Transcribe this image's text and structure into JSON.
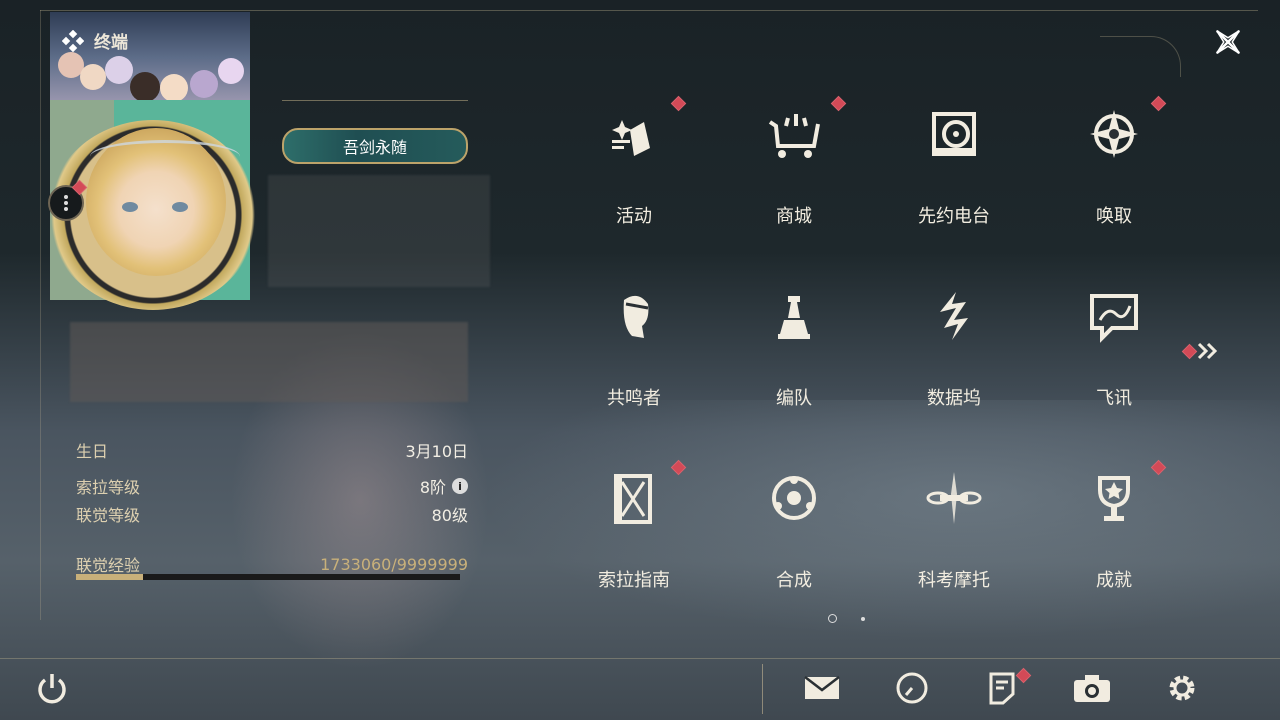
{
  "header": {
    "title": "终端"
  },
  "profile": {
    "title_badge": "吾剑永随",
    "birthday_label": "生日",
    "birthday_value": "3月10日",
    "sola_level_label": "索拉等级",
    "sola_level_value": "8阶",
    "union_level_label": "联觉等级",
    "union_level_value": "80级",
    "union_exp_label": "联觉经验",
    "union_exp_value": "1733060/9999999",
    "union_exp_progress": 0.1733
  },
  "grid": {
    "page1": [
      {
        "label": "活动",
        "icon": "activity-icon",
        "badge": true
      },
      {
        "label": "商城",
        "icon": "shop-cart-icon",
        "badge": true
      },
      {
        "label": "先约电台",
        "icon": "radio-icon",
        "badge": false
      },
      {
        "label": "唤取",
        "icon": "compass-star-icon",
        "badge": true
      },
      {
        "label": "共鸣者",
        "icon": "resonator-portrait-icon",
        "badge": false
      },
      {
        "label": "编队",
        "icon": "chess-team-icon",
        "badge": false
      },
      {
        "label": "数据坞",
        "icon": "data-dock-icon",
        "badge": false
      },
      {
        "label": "飞讯",
        "icon": "chat-bubble-icon",
        "badge": false
      },
      {
        "label": "索拉指南",
        "icon": "guide-book-icon",
        "badge": true
      },
      {
        "label": "合成",
        "icon": "synthesis-orb-icon",
        "badge": false
      },
      {
        "label": "科考摩托",
        "icon": "motorbike-icon",
        "badge": false
      },
      {
        "label": "成就",
        "icon": "trophy-icon",
        "badge": true
      }
    ]
  },
  "pager": {
    "current": 1,
    "total": 2
  },
  "bottom_bar": {
    "left": "power-icon",
    "right": [
      "mail-icon",
      "clock-icon",
      "notice-icon",
      "camera-icon",
      "settings-gear-icon"
    ]
  },
  "colors": {
    "accent": "#c8b07a",
    "badge": "#d34a57",
    "teal": "#2e6e6a"
  }
}
